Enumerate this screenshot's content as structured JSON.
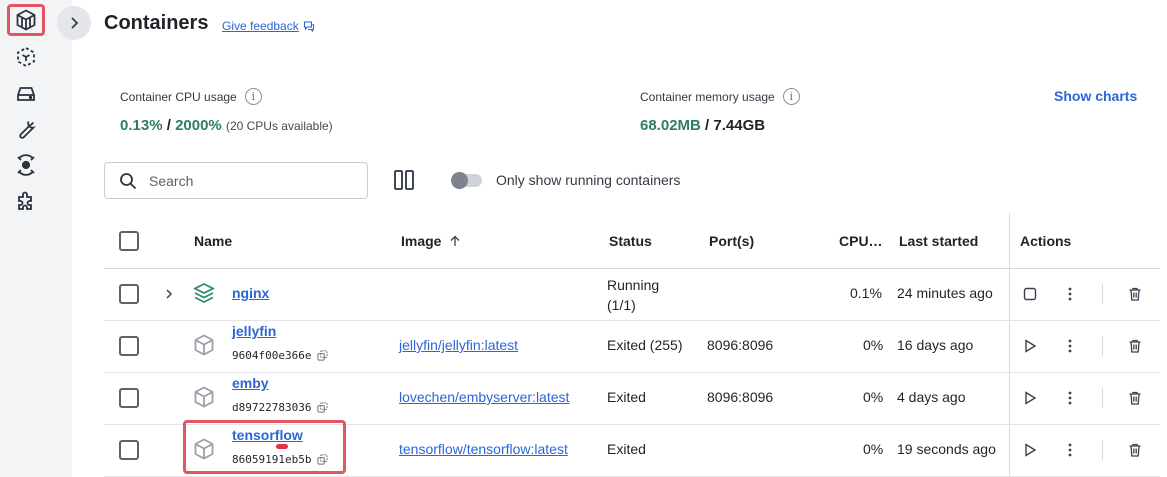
{
  "sidebar": {
    "items": [
      {
        "icon": "containers-icon",
        "active": true
      },
      {
        "icon": "images-icon"
      },
      {
        "icon": "volumes-icon"
      },
      {
        "icon": "dev-environments-icon"
      },
      {
        "icon": "docker-scout-icon"
      },
      {
        "icon": "extensions-icon"
      }
    ]
  },
  "header": {
    "title": "Containers",
    "feedback_label": "Give feedback"
  },
  "stats": {
    "cpu": {
      "label": "Container CPU usage",
      "used": "0.13%",
      "separator": " / ",
      "total": "2000%",
      "note": "(20 CPUs available)"
    },
    "memory": {
      "label": "Container memory usage",
      "used": "68.02MB",
      "separator": " / ",
      "total": "7.44GB"
    },
    "show_charts_label": "Show charts"
  },
  "toolbar": {
    "search_placeholder": "Search",
    "only_running_label": "Only show running containers",
    "only_running_on": false
  },
  "table": {
    "columns": {
      "name": "Name",
      "image": "Image",
      "status": "Status",
      "ports": "Port(s)",
      "cpu": "CPU…",
      "last_started": "Last started",
      "actions": "Actions"
    },
    "sort_column": "Image",
    "rows": [
      {
        "name": "nginx",
        "id": "",
        "image": "",
        "status_line1": "Running",
        "status_line2": "(1/1)",
        "ports": "",
        "cpu": "0.1%",
        "last_started": "24 minutes ago",
        "running": true,
        "group": true
      },
      {
        "name": "jellyfin",
        "id": "9604f00e366e",
        "image": "jellyfin/jellyfin:latest",
        "status_line1": "Exited (255)",
        "status_line2": "",
        "ports": "8096:8096",
        "cpu": "0%",
        "last_started": "16 days ago",
        "running": false
      },
      {
        "name": "emby",
        "id": "d89722783036",
        "image": "lovechen/embyserver:latest",
        "status_line1": "Exited",
        "status_line2": "",
        "ports": "8096:8096",
        "cpu": "0%",
        "last_started": "4 days ago",
        "running": false
      },
      {
        "name": "tensorflow",
        "id": "86059191eb5b",
        "image": "tensorflow/tensorflow:latest",
        "status_line1": "Exited",
        "status_line2": "",
        "ports": "",
        "cpu": "0%",
        "last_started": "19 seconds ago",
        "running": false
      }
    ]
  },
  "colors": {
    "accent": "#2b66d8",
    "green": "#2e7d6a",
    "highlight": "#e25563"
  }
}
